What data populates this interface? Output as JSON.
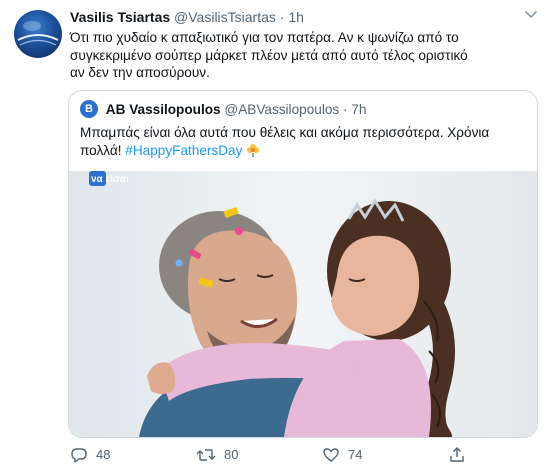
{
  "tweet": {
    "author_name": "Vasilis Tsiartas",
    "handle": "@VasilisTsiartas",
    "separator": "·",
    "time": "1h",
    "text": "Ότι πιο χυδαίο κ απαξιωτικό για τον πατέρα. Αν κ ψωνίζω από το συγκεκριμένο σούπερ μάρκετ πλέον μετά από αυτό τέλος οριστικό αν δεν την αποσύρουν."
  },
  "quoted_tweet": {
    "author_name": "AB Vassilopoulos",
    "handle": "@ABVassilopoulos",
    "separator": "·",
    "time": "7h",
    "text": "Μπαμπάς είναι όλα αυτά που θέλεις και ακόμα περισσότερα. Χρόνια πολλά! ",
    "hashtag": "#HappyFathersDay",
    "avatar_letter": "B",
    "image_brand_text": "να είσαι"
  },
  "actions": {
    "reply_count": "48",
    "retweet_count": "80",
    "like_count": "74"
  },
  "colors": {
    "link_blue": "#1d9bf0",
    "secondary_text": "#536471",
    "border": "#cfd9de"
  },
  "icons": [
    "reply-icon",
    "retweet-icon",
    "like-icon",
    "share-icon",
    "more-caret-icon",
    "flower-emoji-icon"
  ]
}
